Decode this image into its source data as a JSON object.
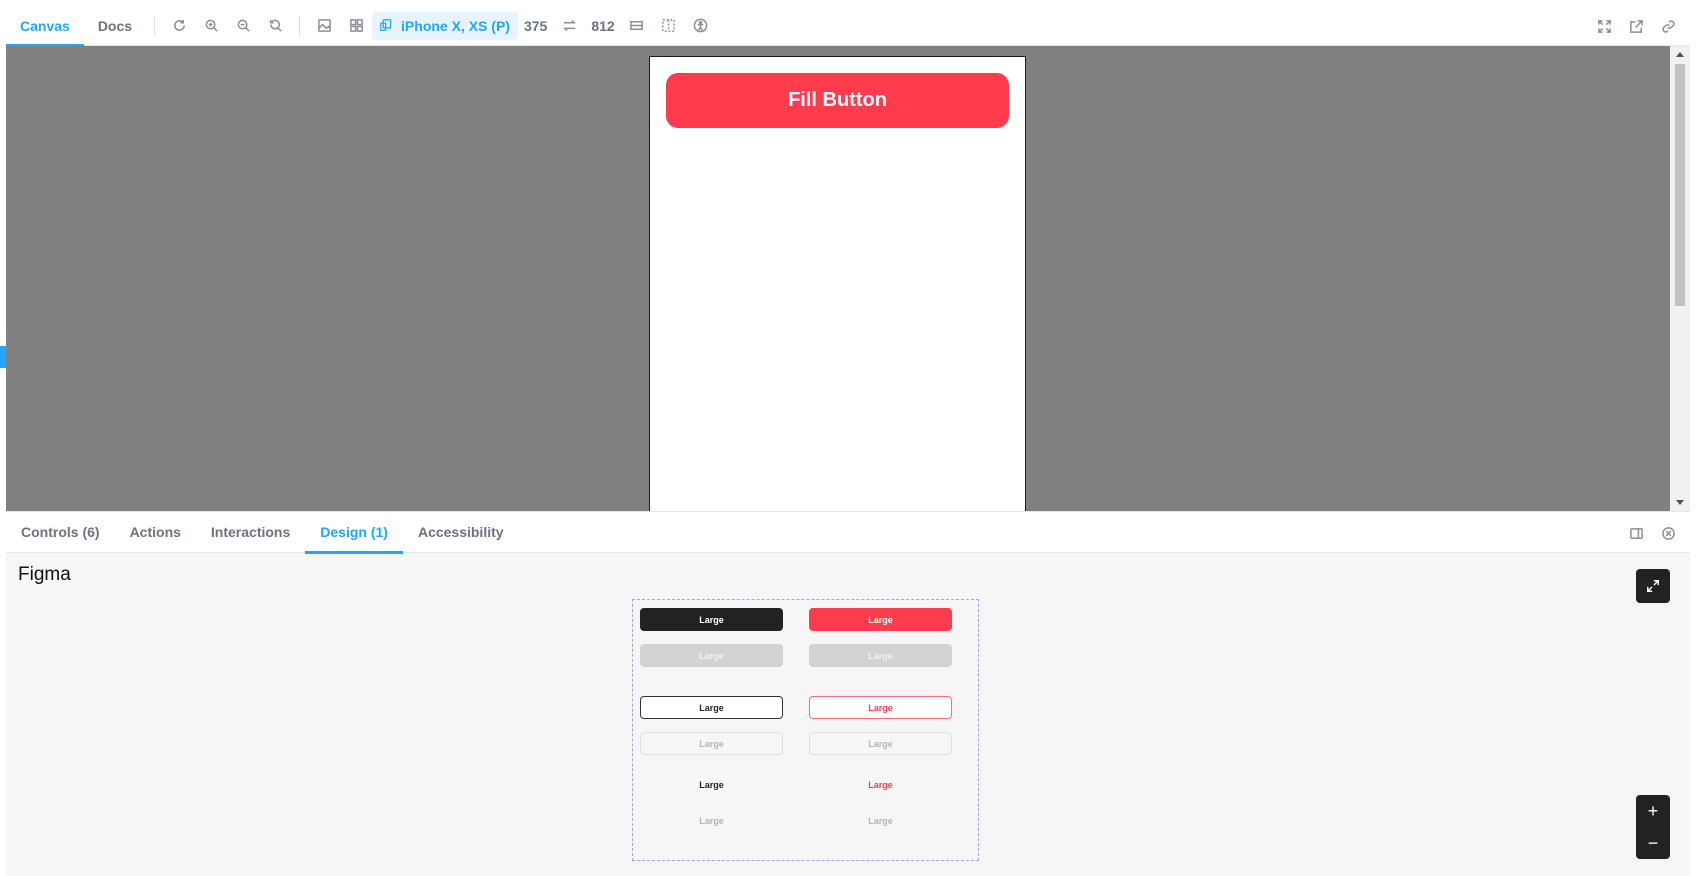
{
  "toolbar": {
    "tabs": [
      {
        "label": "Canvas",
        "active": true
      },
      {
        "label": "Docs",
        "active": false
      }
    ],
    "viewport": "iPhone X, XS (P)",
    "width": "375",
    "height": "812"
  },
  "canvas": {
    "button_label": "Fill Button",
    "button_color": "#ff3b4d",
    "background": "#808080"
  },
  "panel": {
    "tabs": [
      {
        "label": "Controls (6)",
        "active": false
      },
      {
        "label": "Actions",
        "active": false
      },
      {
        "label": "Interactions",
        "active": false
      },
      {
        "label": "Design (1)",
        "active": true
      },
      {
        "label": "Accessibility",
        "active": false
      }
    ],
    "figma_title": "Figma",
    "figma_buttons": {
      "solid_dark": "Large",
      "solid_red": "Large",
      "solid_dark_disabled": "Large",
      "solid_red_disabled": "Large",
      "line_dark": "Large",
      "line_red": "Large",
      "line_dark_disabled": "Large",
      "line_red_disabled": "Large",
      "text_dark": "Large",
      "text_red": "Large",
      "text_dark_disabled": "Large",
      "text_red_disabled": "Large"
    },
    "zoom_in": "+",
    "zoom_out": "−"
  },
  "colors": {
    "accent": "#1ea7fd",
    "brand_red": "#ff3b4d"
  }
}
